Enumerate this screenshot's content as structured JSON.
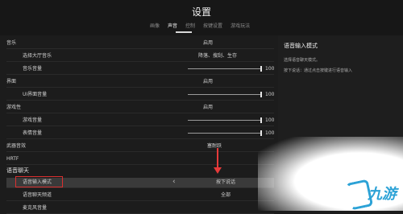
{
  "header": {
    "title": "设置",
    "tabs": [
      "画像",
      "声音",
      "控制",
      "按键设置",
      "游戏玩法"
    ],
    "active_tab": "声音"
  },
  "rows": [
    {
      "label": "音乐",
      "value": "启用"
    },
    {
      "label": "选择大厅音乐",
      "value": "降落、搜刮、生存"
    },
    {
      "label": "音乐音量",
      "slider": 100
    },
    {
      "label": "界面",
      "value": "启用"
    },
    {
      "label": "UI界面音量",
      "slider": 100
    },
    {
      "label": "游戏性",
      "value": "启用"
    },
    {
      "label": "游戏音量",
      "slider": 100
    },
    {
      "label": "表情音量",
      "slider": 100
    },
    {
      "label": "武器音效",
      "value": "塞耐跃"
    },
    {
      "label": "HRTF",
      "value": ""
    }
  ],
  "voice": {
    "section_title": "语音聊天",
    "input_mode_label": "语音输入模式",
    "input_mode_value": "按下说话",
    "channel_label": "语音聊天频道",
    "channel_value": "全部",
    "volume_label": "麦克风音量"
  },
  "panel": {
    "title": "语音输入模式",
    "line1": "选择语音聊天模式。",
    "line2": "按下说话：通过点击按键进行语音输入"
  },
  "watermark": {
    "text": "九游"
  },
  "colors": {
    "highlight_box": "#d93030",
    "arrow": "#e63a3a",
    "logo": "#2ca2d6"
  }
}
